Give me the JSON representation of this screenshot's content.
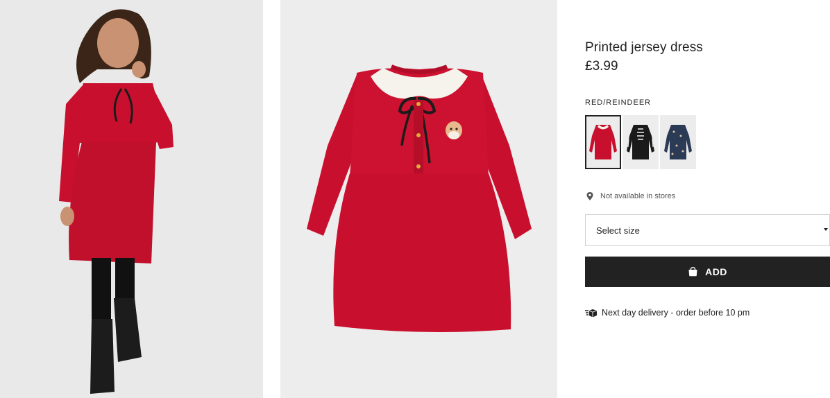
{
  "product": {
    "title": "Printed jersey dress",
    "price": "£3.99",
    "color_name": "RED/REINDEER"
  },
  "swatches": [
    {
      "name": "red-reindeer",
      "selected": true,
      "color": "#c8102e"
    },
    {
      "name": "black-skeleton",
      "selected": false,
      "color": "#1a1a1a"
    },
    {
      "name": "navy-print",
      "selected": false,
      "color": "#2b3a55"
    }
  ],
  "availability": {
    "icon": "location-pin-icon",
    "text": "Not available in stores"
  },
  "size_select": {
    "label": "Select size",
    "icon": "caret-down-icon"
  },
  "add_button": {
    "label": "ADD",
    "icon": "shopping-bag-icon"
  },
  "delivery": {
    "icon": "delivery-boxes-icon",
    "text": "Next day delivery - order before 10 pm"
  },
  "colors": {
    "dress_red": "#c8102e",
    "button_bg": "#222222",
    "image_bg": "#ececec"
  }
}
